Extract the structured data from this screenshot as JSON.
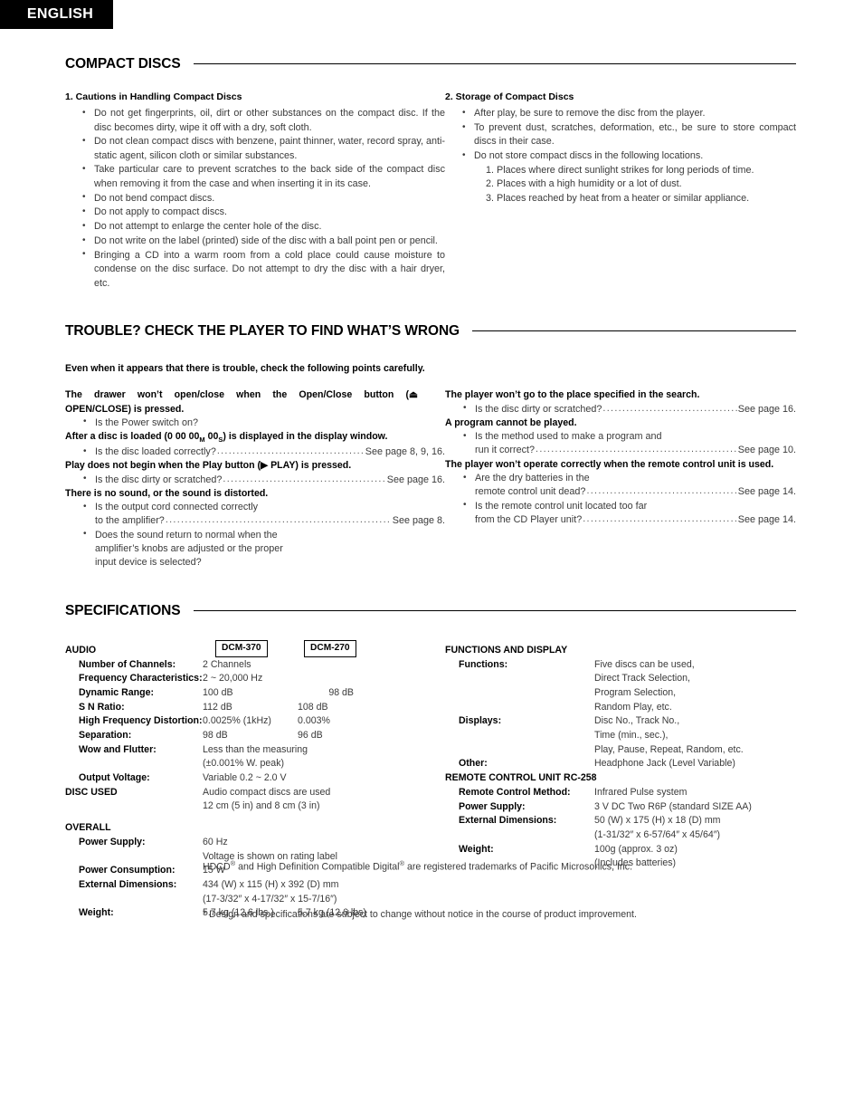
{
  "language_tab": "ENGLISH",
  "sections": {
    "compact_discs": {
      "heading": "COMPACT DISCS",
      "left": {
        "number_heading": "1. Cautions in Handling Compact Discs",
        "bullets": [
          "Do not get fingerprints, oil, dirt or other substances on the compact disc. If the disc becomes dirty, wipe it off with a dry, soft cloth.",
          "Do not clean compact discs with benzene, paint thinner, water, record spray, anti-static agent, silicon cloth or similar substances.",
          "Take particular care to prevent scratches to the back side of the compact disc when removing it from the case and when inserting it in its case.",
          "Do not bend compact discs.",
          "Do not apply to compact discs.",
          "Do not attempt to enlarge the center hole of the disc.",
          "Do not write on the label (printed) side of the disc with a ball point pen or pencil.",
          "Bringing a CD into a warm room from a cold place could cause moisture to condense on the disc surface. Do not attempt to dry the disc with a hair dryer, etc."
        ]
      },
      "right": {
        "number_heading": "2. Storage of Compact Discs",
        "bullets": [
          "After play, be sure to remove the disc from the player.",
          "To prevent dust, scratches, deformation, etc., be sure to store compact discs in their case.",
          "Do not store compact discs in the following locations."
        ],
        "sub_items": [
          "1. Places where direct sunlight strikes for long periods of time.",
          "2. Places with a high humidity or a lot of dust.",
          "3. Places reached by heat from a heater or similar appliance."
        ]
      }
    },
    "trouble": {
      "heading": "TROUBLE? CHECK THE PLAYER TO FIND WHAT’S WRONG",
      "intro": "Even when it appears that there is trouble, check the following points carefully.",
      "left_items": [
        {
          "question_part1": "The drawer won’t open/close when the Open/Close button (⏏",
          "question_part2": "OPEN/CLOSE) is pressed.",
          "answers": [
            {
              "text": "Is the Power switch on?",
              "leader": false,
              "page": ""
            }
          ]
        },
        {
          "question_prefix": "After a disc is loaded (0 00 00",
          "question_sub1": "M",
          "question_mid": " 00",
          "question_sub2": "S",
          "question_suffix": ") is displayed in the display window.",
          "answers": [
            {
              "text": "Is the disc loaded correctly?",
              "leader": true,
              "page": "See page 8, 9, 16."
            }
          ]
        },
        {
          "question_part1": "Play does not begin when the Play button (▶ PLAY) is pressed.",
          "answers": [
            {
              "text": "Is the disc dirty or scratched?",
              "leader": true,
              "page": "See page 16."
            }
          ]
        },
        {
          "question_part1": "There is no sound, or the sound is distorted.",
          "answers": [
            {
              "line1": "Is the output cord connected correctly",
              "line2": "to the amplifier?",
              "leader": true,
              "page": "See page 8."
            },
            {
              "line1": "Does the sound return to normal when the",
              "line2": "amplifier’s knobs are adjusted or the proper",
              "line3": "input device is selected?",
              "leader": false,
              "page": ""
            }
          ]
        }
      ],
      "right_items": [
        {
          "question": "The player won’t go to the place specified in the search.",
          "answers": [
            {
              "text": "Is the disc dirty or scratched?",
              "leader": true,
              "page": "See page 16."
            }
          ]
        },
        {
          "question": "A program cannot be played.",
          "answers": [
            {
              "line1": "Is the method used to make a program and",
              "line2": "run it correct?",
              "leader": true,
              "page": "See page 10."
            }
          ]
        },
        {
          "question": "The player won’t operate correctly when the remote control unit is used.",
          "answers": [
            {
              "line1": "Are the dry batteries in the",
              "line2": "remote control unit dead?",
              "leader": true,
              "page": "See page 14."
            },
            {
              "line1": "Is the remote control unit located too far",
              "line2": "from the CD Player unit?",
              "leader": true,
              "page": "See page 14."
            }
          ]
        }
      ]
    },
    "specifications": {
      "heading": "SPECIFICATIONS",
      "model_box_1": "DCM-370",
      "model_box_2": "DCM-270",
      "left": {
        "group_audio": "AUDIO",
        "audio_rows": [
          {
            "label": "Number of Channels:",
            "val1": "2 Channels",
            "val2": ""
          },
          {
            "label": "Frequency Characteristics:",
            "val1": "2 ~ 20,000 Hz",
            "val2": ""
          },
          {
            "label": "Dynamic Range:",
            "val1": "100 dB",
            "val2": "98 dB"
          },
          {
            "label": "S N Ratio:",
            "val1": "112 dB",
            "val2": "108 dB"
          },
          {
            "label": "High Frequency Distortion:",
            "val1": "0.0025% (1kHz)",
            "val2": "0.003%"
          },
          {
            "label": "Separation:",
            "val1": "98 dB",
            "val2": "96 dB"
          },
          {
            "label": "Wow and Flutter:",
            "val1": "Less than the measuring",
            "val2": ""
          }
        ],
        "wow_cont": "(±0.001% W. peak)",
        "output_voltage": {
          "label": "Output Voltage:",
          "val1": "Variable 0.2 ~ 2.0 V"
        },
        "group_disc_used": "DISC USED",
        "disc_used_val1": "Audio compact discs are used",
        "disc_used_val2": "12 cm (5 in) and 8 cm (3 in)",
        "group_overall": "OVERALL",
        "overall_rows": [
          {
            "label": "Power Supply:",
            "val1": "60 Hz",
            "val2": ""
          }
        ],
        "power_supply_cont": "Voltage is shown on rating label",
        "power_consumption": {
          "label": "Power Consumption:",
          "val1": "15 W"
        },
        "external_dimensions": {
          "label": "External Dimensions:",
          "val1": "434 (W) x 115 (H) x 392 (D) mm"
        },
        "external_dimensions_cont": "(17-3/32″ x 4-17/32″ x 15-7/16″)",
        "weight": {
          "label": "Weight:",
          "val1": "5.7 kg (12.6 lbs.)",
          "val2": "5.7 kg (12.6 lbs)"
        }
      },
      "right": {
        "group_functions": "FUNCTIONS AND DISPLAY",
        "functions_label": "Functions:",
        "functions_values": [
          "Five discs can be used,",
          "Direct Track Selection,",
          "Program Selection,",
          "Random Play, etc."
        ],
        "displays_label": "Displays:",
        "displays_values": [
          "Disc No., Track No.,",
          "Time (min., sec.),",
          "Play, Pause, Repeat, Random, etc."
        ],
        "other_label": "Other:",
        "other_value": "Headphone Jack (Level Variable)",
        "group_remote": "REMOTE CONTROL UNIT RC-258",
        "remote_rows": [
          {
            "label": "Remote Control Method:",
            "val1": "Infrared Pulse system"
          },
          {
            "label": "Power Supply:",
            "val1": "3 V DC Two R6P (standard SIZE AA)"
          },
          {
            "label": "External Dimensions:",
            "val1": "50 (W) x 175 (H) x 18 (D) mm"
          }
        ],
        "remote_dim_cont": "(1-31/32″ x 6-57/64″ x 45/64″)",
        "remote_weight": {
          "label": "Weight:",
          "val1": "100g (approx. 3 oz)"
        },
        "remote_weight_cont": "(Includes batteries)"
      }
    },
    "footer": {
      "trademark_a": "HDCD",
      "trademark_b": " and High Definition Compatible Digital",
      "trademark_c": " are registered trademarks of Pacific Microsonics, Inc.",
      "reg_symbol": "®",
      "disclaimer": "* Design and specifications are subject to change without notice in the course of product improvement."
    }
  },
  "colors": {
    "tab_background": "#000000",
    "tab_text": "#ffffff",
    "heading_text": "#000000",
    "body_text": "#3a3a3a",
    "rule": "#000000"
  }
}
